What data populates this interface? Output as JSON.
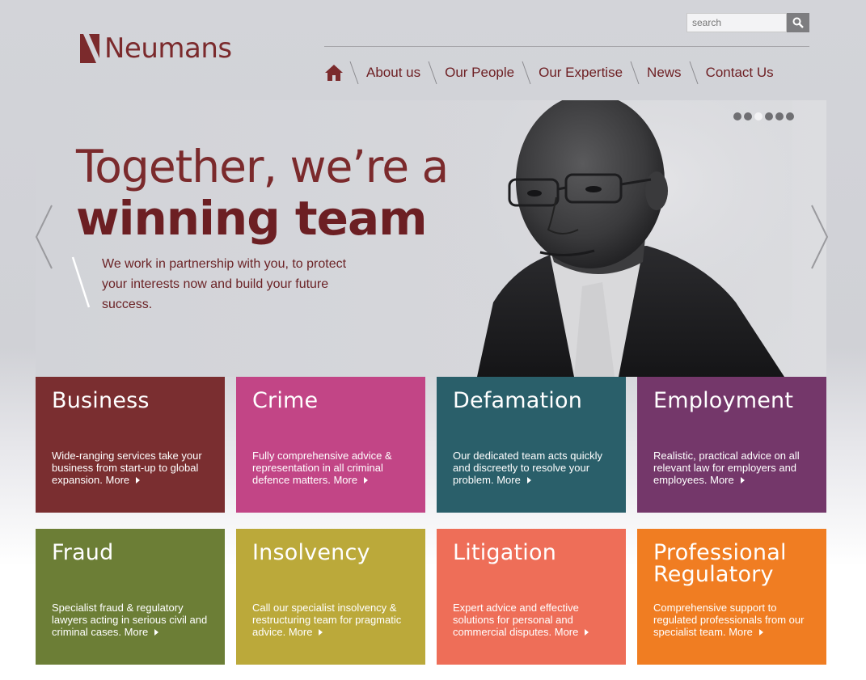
{
  "brand": {
    "name": "Neumans",
    "color": "#7b2a2c"
  },
  "search": {
    "placeholder": "search"
  },
  "nav": {
    "items": [
      {
        "label": "About us"
      },
      {
        "label": "Our People"
      },
      {
        "label": "Our Expertise"
      },
      {
        "label": "News"
      },
      {
        "label": "Contact Us"
      }
    ]
  },
  "hero": {
    "headline_line1": "Together, we’re a",
    "headline_line2": "winning team",
    "subtext": "We work in partnership with you, to protect your interests now and build your future success.",
    "slides_count": 6,
    "active_slide": 3
  },
  "tiles": [
    {
      "title": "Business",
      "desc": "Wide-ranging services take your business from start-up to global expansion.",
      "more": "More",
      "color": "#7a2e30"
    },
    {
      "title": "Crime",
      "desc": "Fully comprehensive advice & representation in all criminal defence matters.",
      "more": "More",
      "color": "#c24586"
    },
    {
      "title": "Defamation",
      "desc": "Our dedicated team acts quickly and discreetly to resolve your problem.",
      "more": "More",
      "color": "#2a5f6a"
    },
    {
      "title": "Employment",
      "desc": "Realistic, practical advice on all relevant law for employers and employees.",
      "more": "More",
      "color": "#74376a"
    },
    {
      "title": "Fraud",
      "desc": "Specialist fraud & regulatory lawyers acting in serious civil and criminal cases.",
      "more": "More",
      "color": "#6c7e36"
    },
    {
      "title": "Insolvency",
      "desc": "Call our specialist insolvency & restructuring team for pragmatic advice.",
      "more": "More",
      "color": "#bba93a"
    },
    {
      "title": "Litigation",
      "desc": "Expert advice and effective solutions for personal and commercial disputes.",
      "more": "More",
      "color": "#ee6e58"
    },
    {
      "title": "Professional Regulatory",
      "desc": "Comprehensive support to regulated professionals from our specialist team.",
      "more": "More",
      "color": "#f07d22"
    }
  ]
}
